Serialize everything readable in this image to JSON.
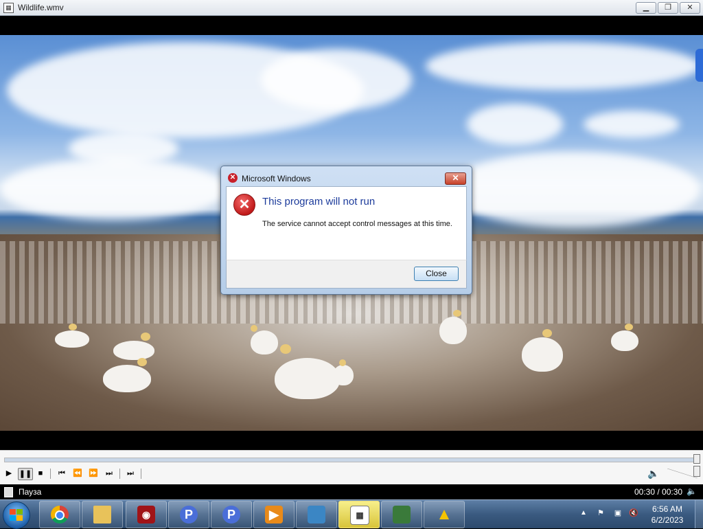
{
  "window": {
    "title": "Wildlife.wmv",
    "minimize_icon": "minimize-icon",
    "maximize_icon": "restore-icon",
    "close_icon": "close-icon"
  },
  "dialog": {
    "title": "Microsoft Windows",
    "heading": "This program will not run",
    "message": "The service cannot accept control messages at this time.",
    "close_button": "Close",
    "icon": "error-icon",
    "colors": {
      "heading": "#1c3b9b",
      "error": "#c11a1a"
    }
  },
  "player": {
    "seek_progress": 1.0,
    "volume_level": 1.0,
    "controls": [
      "play",
      "pause",
      "stop",
      "previous",
      "rewind",
      "fast-forward",
      "next",
      "switch-to-library"
    ]
  },
  "statusbar": {
    "status": "Пауза",
    "time": "00:30 / 00:30"
  },
  "taskbar": {
    "apps": [
      "chrome",
      "file-explorer",
      "screen-recorder",
      "p-app",
      "p-app-2",
      "media-player",
      "photo-viewer",
      "calendar-app",
      "network-monitor",
      "warning-app"
    ],
    "clock_time": "6:56 AM",
    "clock_date": "6/2/2023"
  }
}
